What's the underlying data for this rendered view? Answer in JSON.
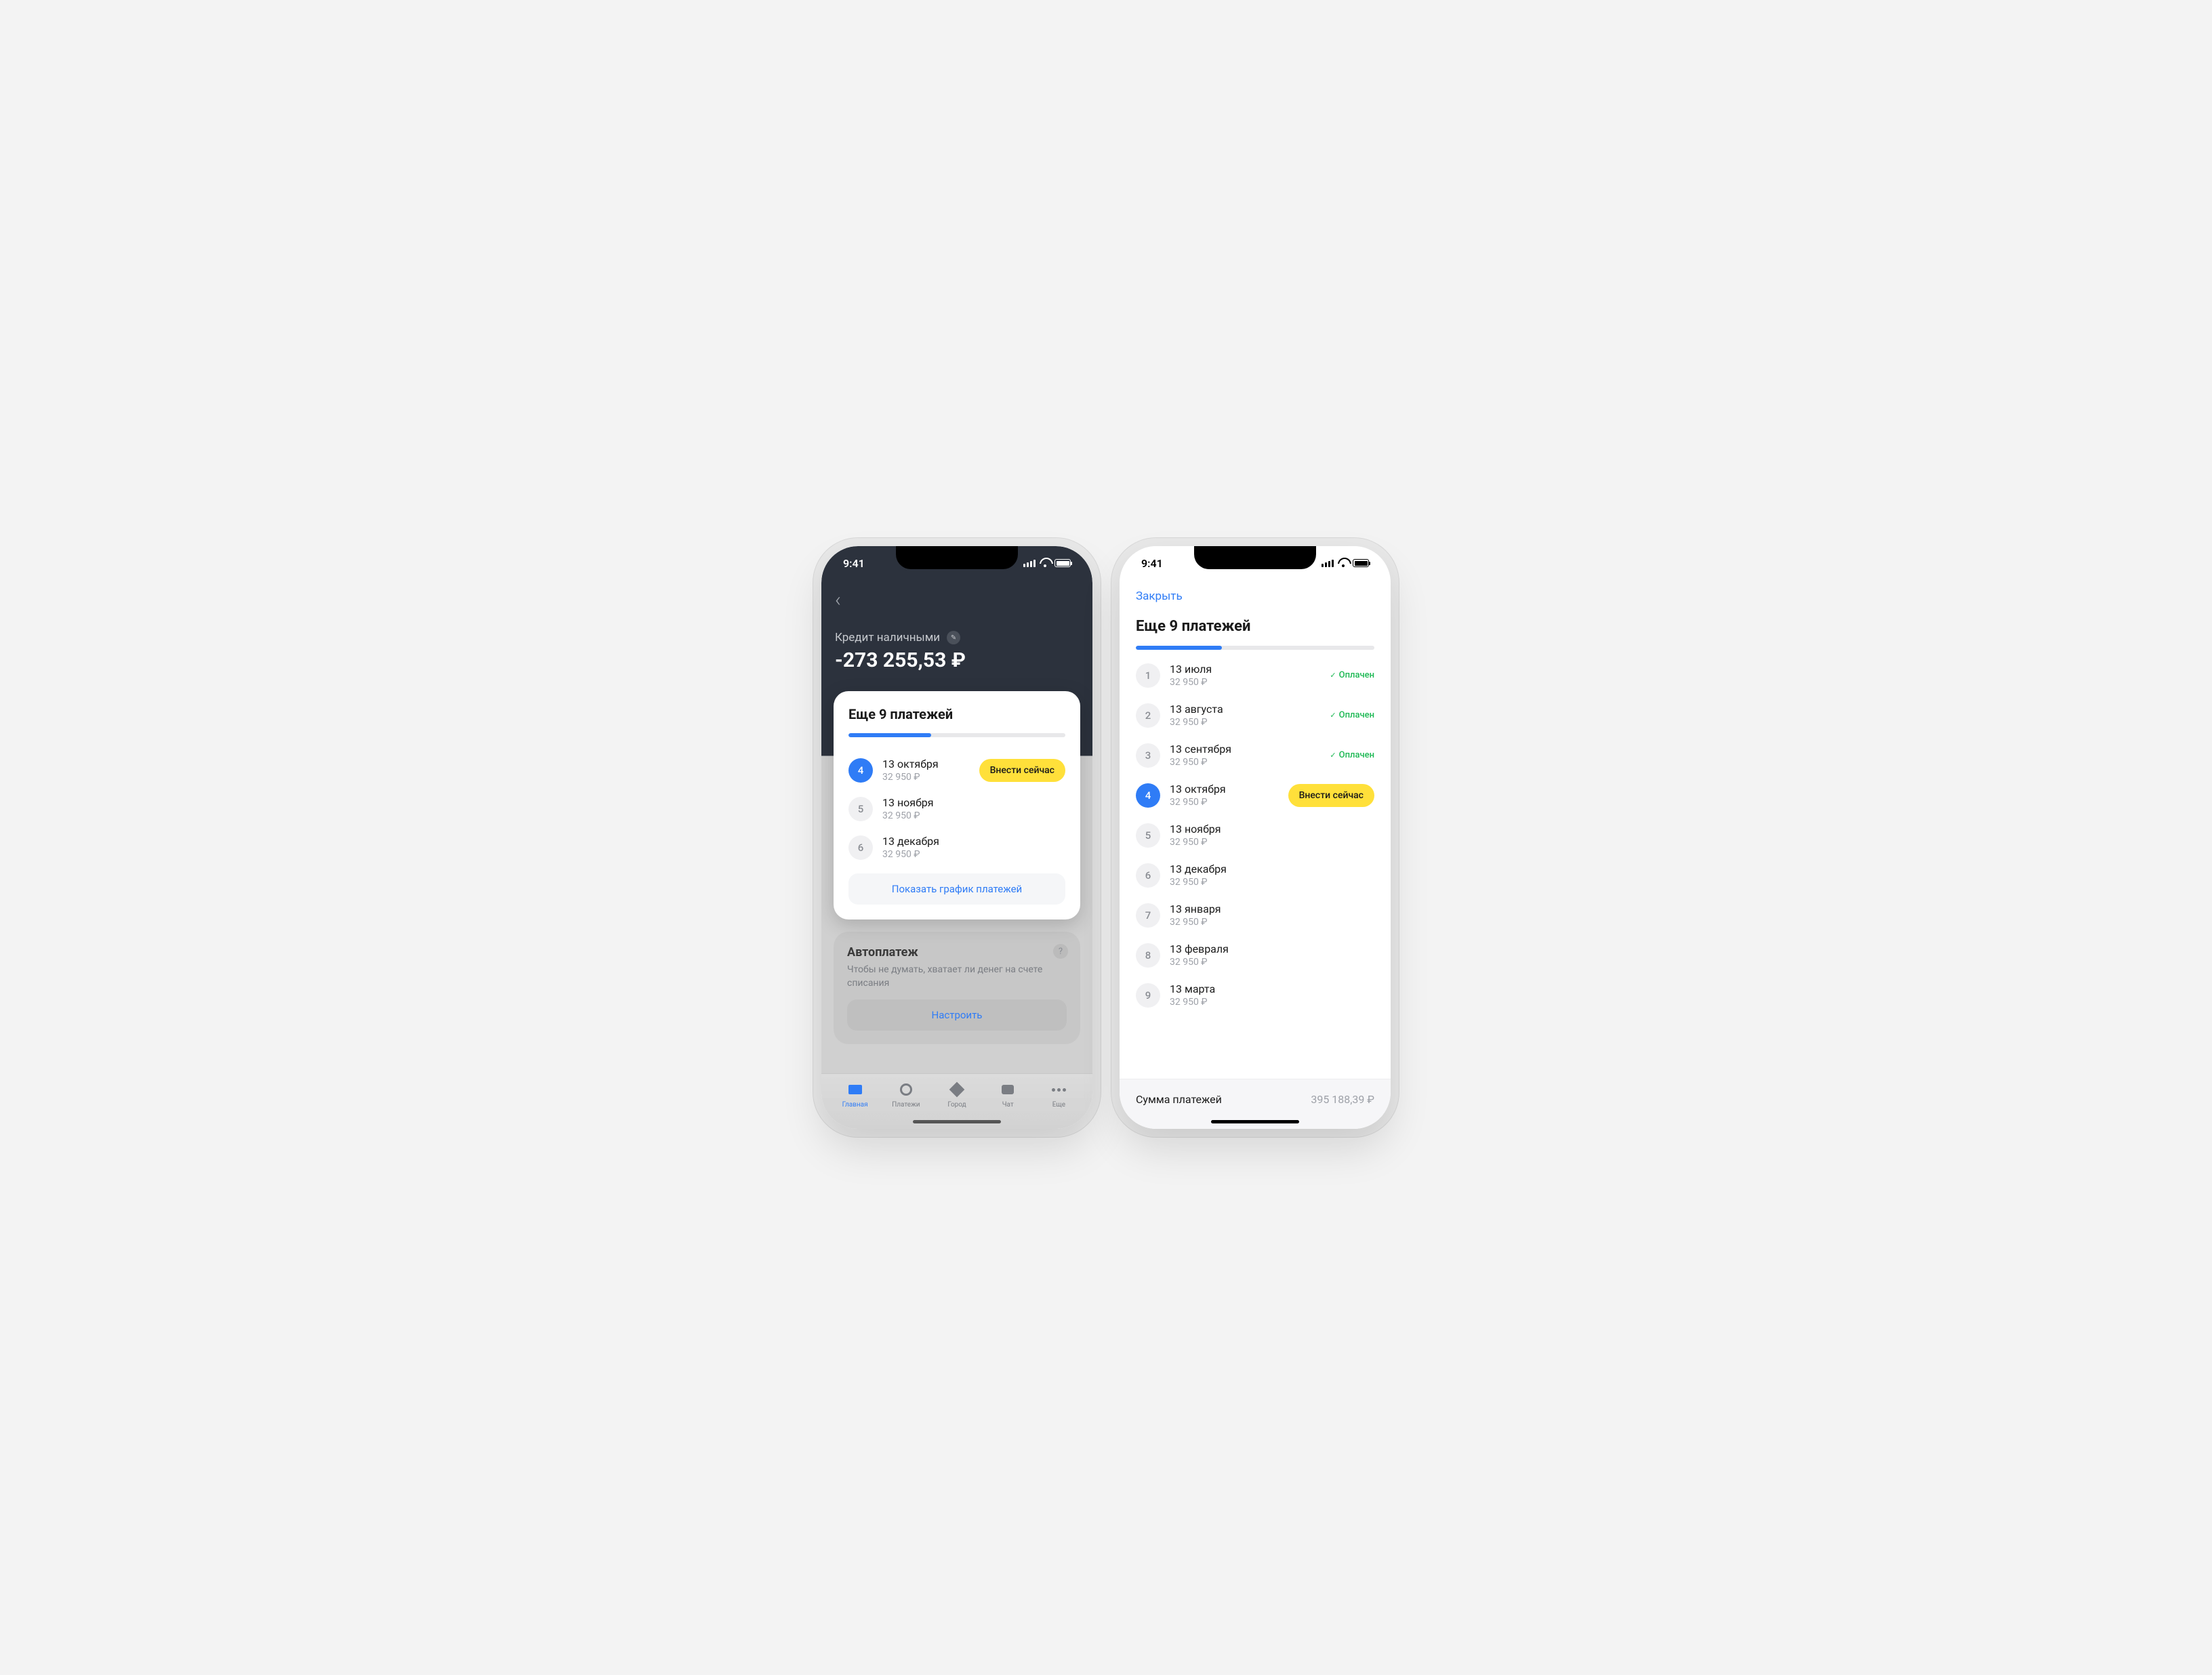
{
  "status_time": "9:41",
  "phone1": {
    "loan_title": "Кредит наличными",
    "loan_amount": "-273 255,53 ₽",
    "card_title": "Еще 9 платежей",
    "payments": [
      {
        "num": "4",
        "date": "13 октября",
        "amount": "32 950 ₽",
        "active": true,
        "action": "Внести сейчас"
      },
      {
        "num": "5",
        "date": "13 ноября",
        "amount": "32 950 ₽"
      },
      {
        "num": "6",
        "date": "13 декабря",
        "amount": "32 950 ₽"
      }
    ],
    "show_schedule": "Показать график платежей",
    "autopay": {
      "title": "Автоплатеж",
      "desc": "Чтобы не думать, хватает ли денег на счете списания",
      "button": "Настроить"
    },
    "tabs": [
      {
        "label": "Главная"
      },
      {
        "label": "Платежи"
      },
      {
        "label": "Город"
      },
      {
        "label": "Чат"
      },
      {
        "label": "Еще"
      }
    ]
  },
  "phone2": {
    "close": "Закрыть",
    "title": "Еще 9 платежей",
    "payments": [
      {
        "num": "1",
        "date": "13 июля",
        "amount": "32 950 ₽",
        "status": "Оплачен"
      },
      {
        "num": "2",
        "date": "13 августа",
        "amount": "32 950 ₽",
        "status": "Оплачен"
      },
      {
        "num": "3",
        "date": "13 сентября",
        "amount": "32 950 ₽",
        "status": "Оплачен"
      },
      {
        "num": "4",
        "date": "13 октября",
        "amount": "32 950 ₽",
        "active": true,
        "action": "Внести сейчас"
      },
      {
        "num": "5",
        "date": "13 ноября",
        "amount": "32 950 ₽"
      },
      {
        "num": "6",
        "date": "13 декабря",
        "amount": "32 950 ₽"
      },
      {
        "num": "7",
        "date": "13 января",
        "amount": "32 950 ₽"
      },
      {
        "num": "8",
        "date": "13 февраля",
        "amount": "32 950 ₽"
      },
      {
        "num": "9",
        "date": "13 марта",
        "amount": "32 950 ₽"
      }
    ],
    "footer_label": "Сумма платежей",
    "footer_value": "395 188,39 ₽"
  }
}
